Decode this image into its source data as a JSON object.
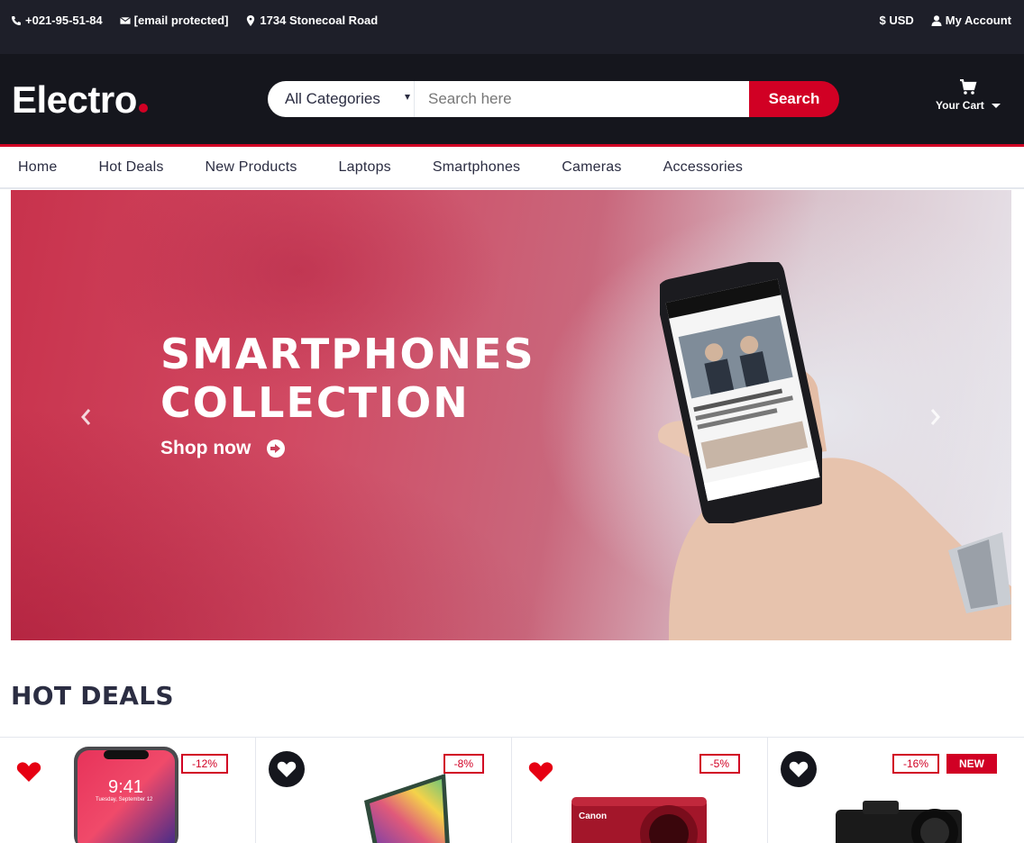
{
  "topbar": {
    "phone": "+021-95-51-84",
    "email": "[email protected]",
    "address": "1734 Stonecoal Road",
    "currency": "$ USD",
    "account": "My Account"
  },
  "header": {
    "logo": "Electro",
    "category_selected": "All Categories",
    "search_placeholder": "Search here",
    "search_button": "Search",
    "cart_label": "Your Cart"
  },
  "nav": {
    "items": [
      {
        "label": "Home"
      },
      {
        "label": "Hot Deals"
      },
      {
        "label": "New Products"
      },
      {
        "label": "Laptops"
      },
      {
        "label": "Smartphones"
      },
      {
        "label": "Cameras"
      },
      {
        "label": "Accessories"
      }
    ]
  },
  "hero": {
    "title_line1": "SMARTPHONES",
    "title_line2": "COLLECTION",
    "cta": "Shop now"
  },
  "hot_deals": {
    "title": "HOT DEALS",
    "products": [
      {
        "discount": "-12%",
        "new": "",
        "wishlisted": true,
        "kind": "smartphone",
        "screen_time": "9:41",
        "screen_date": "Tuesday, September 12"
      },
      {
        "discount": "-8%",
        "new": "",
        "wishlisted": false,
        "kind": "laptop"
      },
      {
        "discount": "-5%",
        "new": "",
        "wishlisted": true,
        "kind": "camera",
        "brand": "Canon"
      },
      {
        "discount": "-16%",
        "new": "NEW",
        "wishlisted": false,
        "kind": "dslr"
      }
    ]
  },
  "colors": {
    "accent": "#d10024",
    "dark": "#15161d",
    "topbar": "#1e1f29",
    "text": "#2b2d42"
  }
}
